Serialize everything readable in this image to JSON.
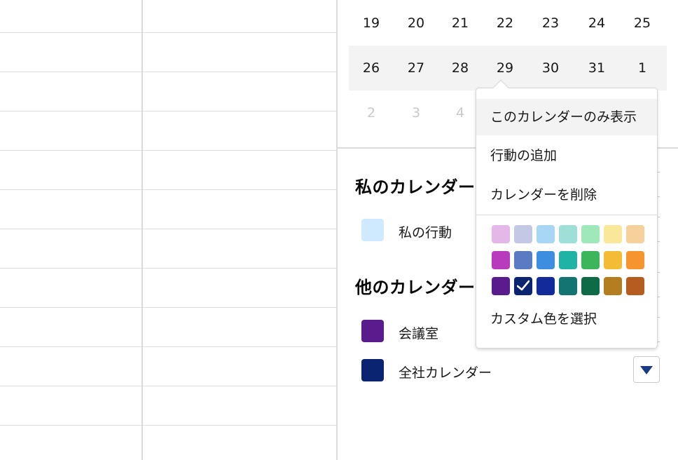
{
  "mini_calendar": {
    "weeks": [
      [
        "19",
        "20",
        "21",
        "22",
        "23",
        "24",
        "25"
      ],
      [
        "26",
        "27",
        "28",
        "29",
        "30",
        "31",
        "1"
      ],
      [
        "2",
        "3",
        "4"
      ]
    ]
  },
  "sections": {
    "my_calendars_title": "私のカレンダー",
    "other_calendars_title": "他のカレンダー"
  },
  "my_calendars": [
    {
      "label": "私の行動",
      "color": "#cfe9fe"
    }
  ],
  "other_calendars": [
    {
      "label": "会議室",
      "color": "#5a1b8c"
    },
    {
      "label": "全社カレンダー",
      "color": "#0a2472"
    }
  ],
  "context_menu": {
    "items": [
      "このカレンダーのみ表示",
      "行動の追加",
      "カレンダーを削除"
    ],
    "highlighted_item": "このカレンダーのみ表示",
    "palette": [
      [
        "#e3b8e8",
        "#c3c8e4",
        "#a8d6f5",
        "#9ee0d7",
        "#9ee8b9",
        "#f9e79a",
        "#f7d19b"
      ],
      [
        "#b93bbd",
        "#5a7bc4",
        "#3d8ee0",
        "#1fb3a6",
        "#3cb55b",
        "#f4bb35",
        "#f6952e"
      ],
      [
        "#5a1b8c",
        "#0a2472",
        "#132b9a",
        "#147472",
        "#0e6b47",
        "#b37d20",
        "#b75c21"
      ]
    ],
    "selected_color": "#0a2472",
    "custom_color_label": "カスタム色を選択"
  },
  "colors": {
    "grid_line": "#dddbda",
    "selected_week_bg": "#f3f3f3",
    "dropdown_icon": "#1b3a86"
  }
}
